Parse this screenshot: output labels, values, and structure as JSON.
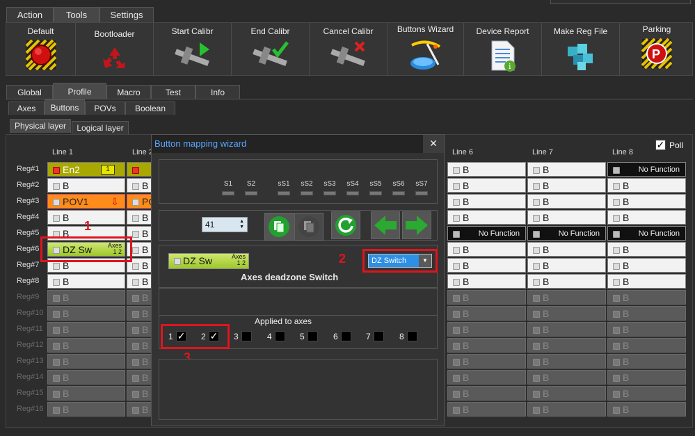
{
  "menu": {
    "tabs": [
      "Action",
      "Tools",
      "Settings"
    ],
    "active": "Tools"
  },
  "toolbar": [
    {
      "label": "Default",
      "icon": "default-stop-icon"
    },
    {
      "label": "Bootloader",
      "icon": "recycle-icon"
    },
    {
      "label": "Start Calibr",
      "icon": "caliper-play-icon"
    },
    {
      "label": "End Calibr",
      "icon": "caliper-check-icon"
    },
    {
      "label": "Cancel Calibr",
      "icon": "caliper-cancel-icon"
    },
    {
      "label": "Buttons Wizard",
      "icon": "wizard-icon"
    },
    {
      "label": "Device Report",
      "icon": "report-icon"
    },
    {
      "label": "Make Reg File",
      "icon": "cubes-icon"
    },
    {
      "label": "Parking",
      "icon": "parking-icon"
    }
  ],
  "tabs_main": [
    "Global",
    "Profile",
    "Macro",
    "Test",
    "Info"
  ],
  "tabs_sub": [
    "Axes",
    "Buttons",
    "POVs",
    "Boolean"
  ],
  "tabs_layer": [
    "Physical layer",
    "Logical layer"
  ],
  "poll": {
    "label": "Poll",
    "checked": true
  },
  "columns": [
    "Line 1",
    "Line 2",
    "Line 6",
    "Line 7",
    "Line 8"
  ],
  "rows": [
    "Reg#1",
    "Reg#2",
    "Reg#3",
    "Reg#4",
    "Reg#5",
    "Reg#6",
    "Reg#7",
    "Reg#8",
    "Reg#9",
    "Reg#10",
    "Reg#11",
    "Reg#12",
    "Reg#13",
    "Reg#14",
    "Reg#15",
    "Reg#16"
  ],
  "cells": {
    "b": "B",
    "no_function": "No Function",
    "en2": "En2",
    "en2_badge": "1",
    "pov1": "POV1",
    "pov_partial": "PO",
    "dzsw": "DZ Sw",
    "axes_word": "Axes",
    "axes_nums": "1 2"
  },
  "dialog": {
    "title": "Button mapping wizard",
    "close": "✕",
    "shift_labels": [
      "S1",
      "S2",
      "sS1",
      "sS2",
      "sS3",
      "sS4",
      "sS5",
      "sS6",
      "sS7"
    ],
    "spin_value": "41",
    "preview_name": "DZ Sw",
    "preview_axes": "Axes",
    "preview_nums": "1 2",
    "function_title": "Axes deadzone Switch",
    "dropdown_value": "DZ Switch",
    "applied_label": "Applied to axes",
    "axes": [
      {
        "n": "1",
        "checked": true
      },
      {
        "n": "2",
        "checked": true
      },
      {
        "n": "3",
        "checked": false
      },
      {
        "n": "4",
        "checked": false
      },
      {
        "n": "5",
        "checked": false
      },
      {
        "n": "6",
        "checked": false
      },
      {
        "n": "7",
        "checked": false
      },
      {
        "n": "8",
        "checked": false
      }
    ]
  },
  "annotations": [
    "1",
    "2",
    "3"
  ],
  "colors": {
    "highlight": "#e0141e",
    "title_blue": "#59a6ff",
    "cell_green": "#b5d84a",
    "cell_orange": "#ff8c1a",
    "cell_olive": "#a8a800"
  }
}
